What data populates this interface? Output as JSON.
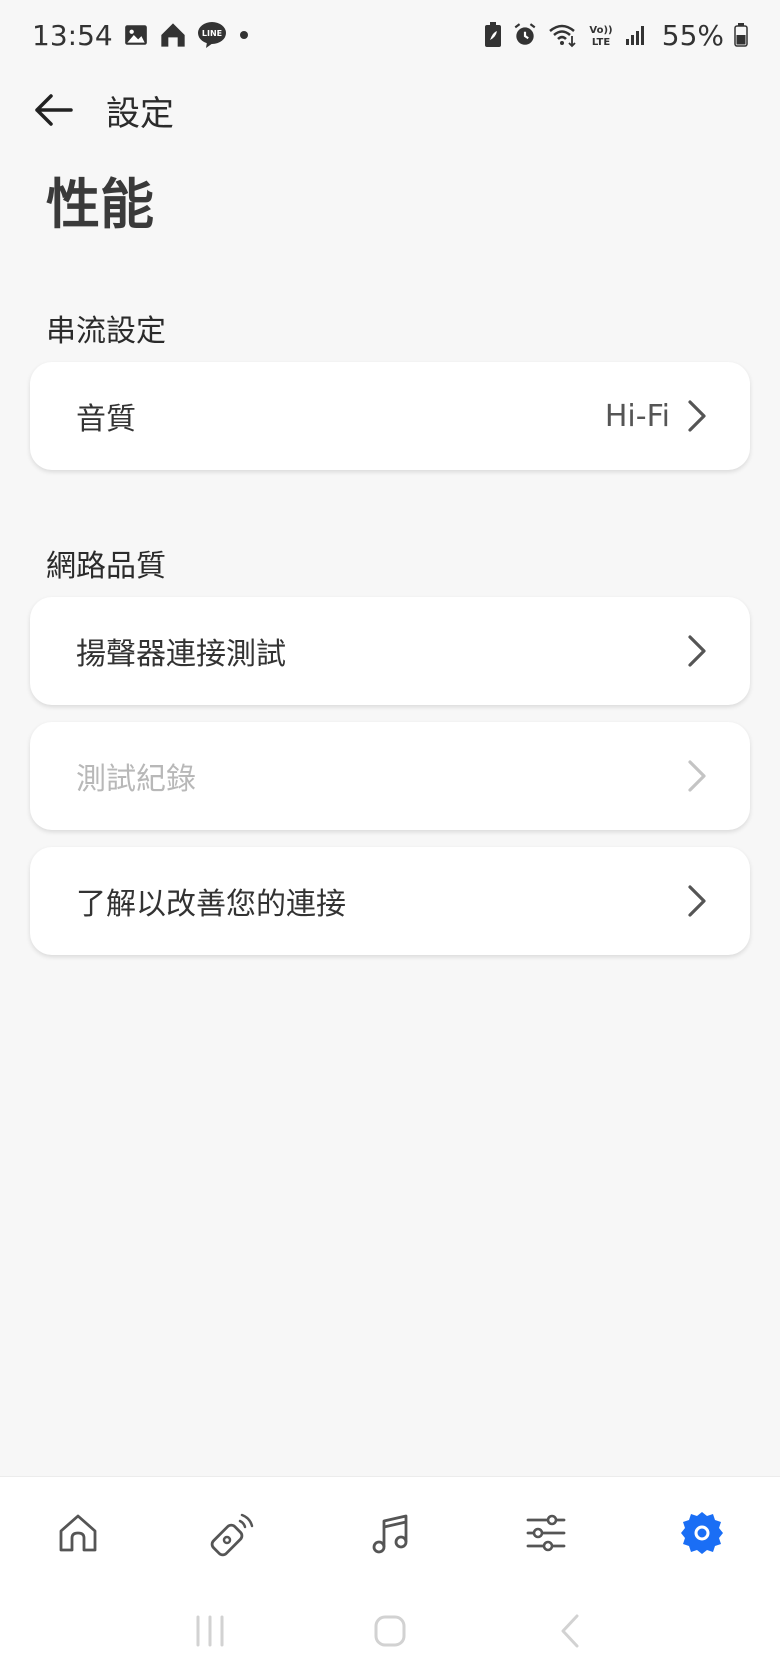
{
  "status_bar": {
    "time": "13:54",
    "battery": "55%",
    "left_icons": [
      "gallery-icon",
      "home-app-icon",
      "line-icon",
      "dot-icon"
    ],
    "right_icons": [
      "battery-saver-icon",
      "alarm-icon",
      "wifi-icon",
      "volte-icon",
      "signal-icon"
    ]
  },
  "app_bar": {
    "title": "設定"
  },
  "page": {
    "title": "性能"
  },
  "sections": {
    "streaming": {
      "label": "串流設定",
      "items": [
        {
          "label": "音質",
          "value": "Hi-Fi"
        }
      ]
    },
    "network": {
      "label": "網路品質",
      "items": [
        {
          "label": "揚聲器連接測試",
          "disabled": false
        },
        {
          "label": "測試紀錄",
          "disabled": true
        },
        {
          "label": "了解以改善您的連接",
          "disabled": false
        }
      ]
    }
  },
  "bottom_nav": {
    "items": [
      "home-icon",
      "remote-icon",
      "music-icon",
      "sliders-icon",
      "settings-icon"
    ],
    "active": "settings-icon",
    "active_color": "#1a6ef5",
    "inactive_color": "#555555"
  },
  "system_nav": [
    "recents-icon",
    "home-button-icon",
    "back-button-icon"
  ]
}
